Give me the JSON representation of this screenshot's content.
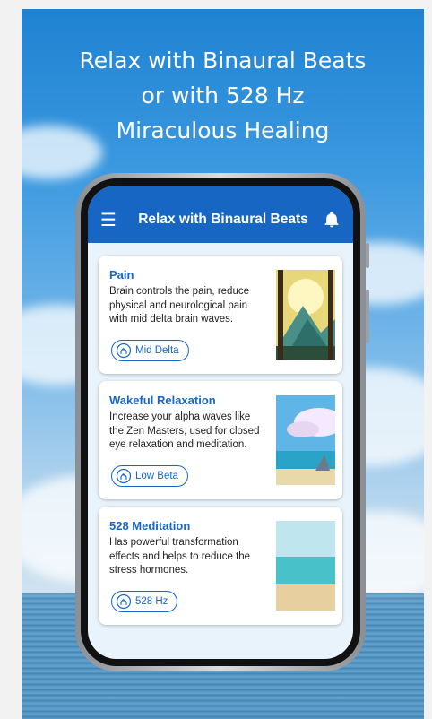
{
  "headline": {
    "line1": "Relax with Binaural Beats",
    "line2": "or with 528 Hz",
    "line3": "Miraculous Healing"
  },
  "app_bar": {
    "menu_icon": "hamburger-menu-icon",
    "title": "Relax with Binaural Beats",
    "notification_icon": "bell-icon"
  },
  "cards": [
    {
      "title": "Pain",
      "description": "Brain controls the pain, reduce physical and neurological pain with mid delta brain waves.",
      "chip_label": "Mid Delta",
      "chip_icon": "head-waves-icon"
    },
    {
      "title": "Wakeful Relaxation",
      "description": "Increase your alpha waves like the Zen Masters, used for closed eye relaxation and meditation.",
      "chip_label": "Low Beta",
      "chip_icon": "head-waves-icon"
    },
    {
      "title": "528 Meditation",
      "description": "Has powerful transformation effects and helps to reduce the stress hormones.",
      "chip_label": "528 Hz",
      "chip_icon": "head-waves-icon"
    }
  ],
  "colors": {
    "primary": "#1766c4",
    "screen_bg": "#e8f3fb"
  }
}
